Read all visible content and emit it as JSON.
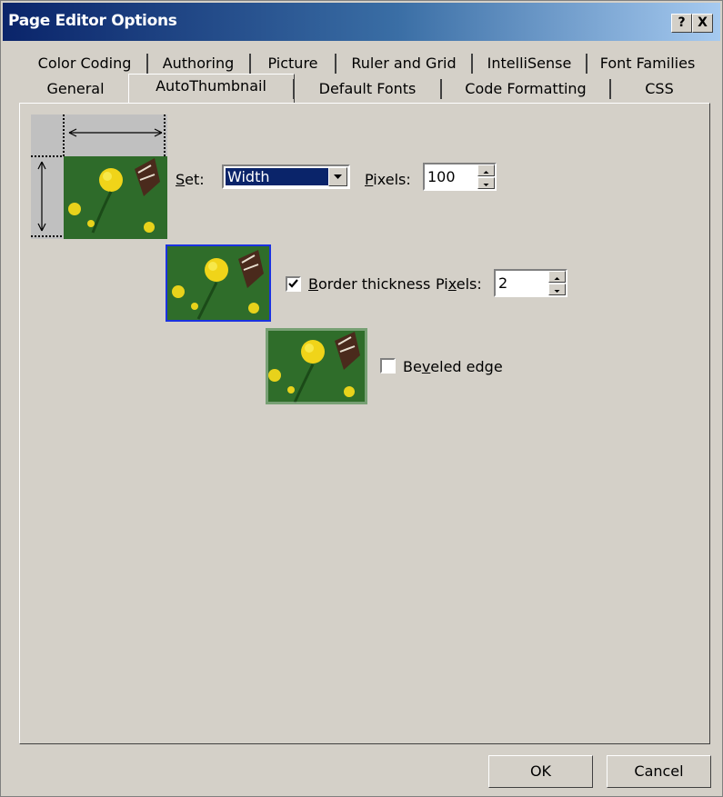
{
  "window": {
    "title": "Page Editor Options",
    "help_label": "?",
    "close_label": "X"
  },
  "tabs": {
    "row1": [
      "Color Coding",
      "Authoring",
      "Picture",
      "Ruler and Grid",
      "IntelliSense",
      "Font Families"
    ],
    "row2": [
      "General",
      "AutoThumbnail",
      "Default Fonts",
      "Code Formatting",
      "CSS"
    ],
    "active": "AutoThumbnail"
  },
  "set": {
    "label_pre": "",
    "label_key": "S",
    "label_post": "et:",
    "value": "Width"
  },
  "pixels1": {
    "label_key": "P",
    "label_post": "ixels:",
    "value": "100"
  },
  "border": {
    "checked": true,
    "label_key": "B",
    "label_post": "order thickness"
  },
  "pixels2": {
    "label_pre": "Pi",
    "label_key": "x",
    "label_post": "els:",
    "value": "2"
  },
  "beveled": {
    "checked": false,
    "label_pre": "Be",
    "label_key": "v",
    "label_post": "eled edge"
  },
  "buttons": {
    "ok": "OK",
    "cancel": "Cancel"
  },
  "colors": {
    "title_bar": "#0a246a",
    "selection": "#0a246a",
    "border_highlight": "#1a32e0"
  }
}
